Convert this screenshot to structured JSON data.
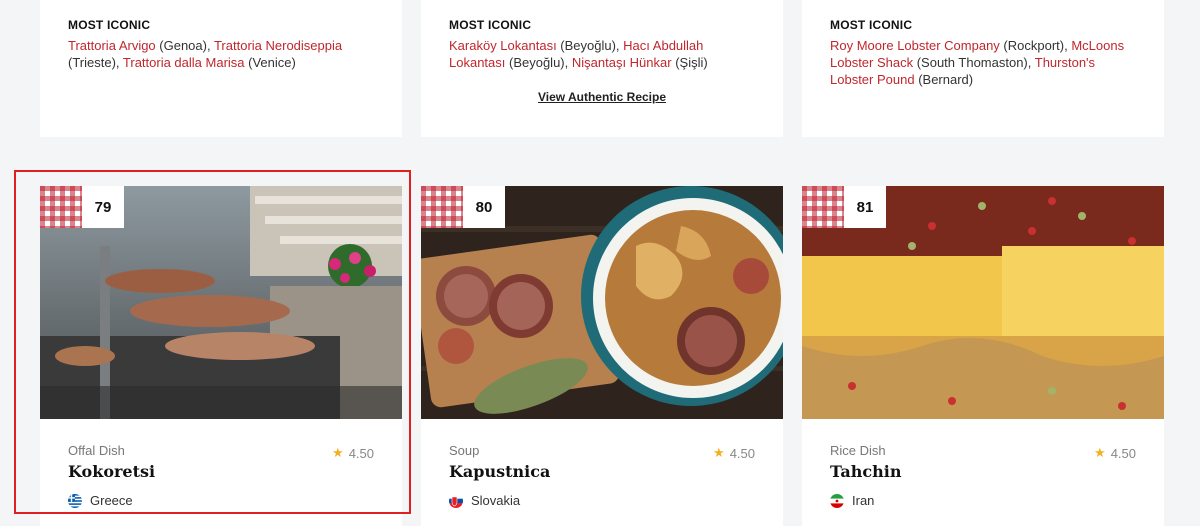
{
  "top_cards": [
    {
      "label": "MOST ICONIC",
      "parts": [
        {
          "type": "link",
          "text": "Trattoria Arvigo"
        },
        {
          "type": "text",
          "text": " (Genoa), "
        },
        {
          "type": "link",
          "text": "Trattoria Nerodiseppia"
        },
        {
          "type": "text",
          "text": " (Trieste), "
        },
        {
          "type": "link",
          "text": "Trattoria dalla Marisa"
        },
        {
          "type": "text",
          "text": " (Venice)"
        }
      ]
    },
    {
      "label": "MOST ICONIC",
      "parts": [
        {
          "type": "link",
          "text": "Karaköy Lokantası"
        },
        {
          "type": "text",
          "text": " (Beyoğlu), "
        },
        {
          "type": "link",
          "text": "Hacı Abdullah Lokantası"
        },
        {
          "type": "text",
          "text": " (Beyoğlu), "
        },
        {
          "type": "link",
          "text": "Nişantaşı Hünkar"
        },
        {
          "type": "text",
          "text": " (Şişli)"
        }
      ],
      "view_link": "View Authentic Recipe"
    },
    {
      "label": "MOST ICONIC",
      "parts": [
        {
          "type": "link",
          "text": "Roy Moore Lobster Company"
        },
        {
          "type": "text",
          "text": " (Rockport), "
        },
        {
          "type": "link",
          "text": "McLoons Lobster Shack"
        },
        {
          "type": "text",
          "text": " (South Thomaston), "
        },
        {
          "type": "link",
          "text": "Thurston's Lobster Pound"
        },
        {
          "type": "text",
          "text": " (Bernard)"
        }
      ]
    }
  ],
  "dishes": [
    {
      "rank": "79",
      "category": "Offal Dish",
      "rating": "4.50",
      "name": "Kokoretsi",
      "country": "Greece",
      "flag": "greece-flag-icon"
    },
    {
      "rank": "80",
      "category": "Soup",
      "rating": "4.50",
      "name": "Kapustnica",
      "country": "Slovakia",
      "flag": "slovakia-flag-icon"
    },
    {
      "rank": "81",
      "category": "Rice Dish",
      "rating": "4.50",
      "name": "Tahchin",
      "country": "Iran",
      "flag": "iran-flag-icon"
    }
  ],
  "colors": {
    "link": "#c0272d",
    "highlight": "#e02020",
    "star": "#f2b01e"
  }
}
